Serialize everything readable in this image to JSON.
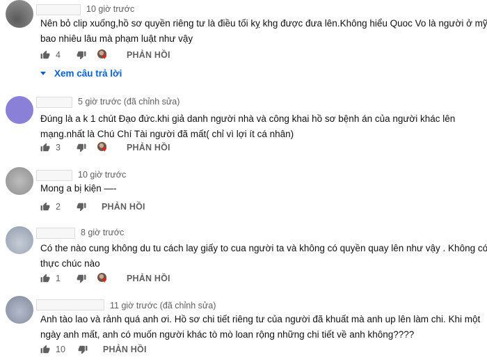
{
  "reply_label": "PHẢN HỒI",
  "comments": [
    {
      "time": "10 giờ trước",
      "line1": "Nên bỏ clip xuống,hồ sơ quyền riêng tư là điều tối kỵ khg được đưa lên.Không hiểu Quoc Vo là người ở mỹ",
      "line2": "bao nhiêu lâu mà phạm luật như vậy",
      "likes": "4",
      "view_replies": "Xem câu trả lời"
    },
    {
      "time": "5 giờ trước (đã chỉnh sửa)",
      "line1": "Đúng là a k 1 chút Đạo đức.khi giả danh người nhà và công khai hồ sơ bệnh án của người khác lên",
      "line2": "mạng.nhất là Chú Chí Tài người đã mất( chỉ vì lợi ít cá nhân)",
      "likes": "3"
    },
    {
      "time": "10 giờ trước",
      "line1": "Mong a bị kiện —-",
      "likes": "2"
    },
    {
      "time": "8 giờ trước",
      "line1": "Có the nào cung không du tu cách lay giấy to cua người ta và không có quyền quay lên như vậy . Không có y",
      "line2": "thực chúc nào",
      "likes": "1"
    },
    {
      "time": "11 giờ trước (đã chỉnh sửa)",
      "line1": "Anh tào lao và rảnh quá anh ơi. Hồ sơ chi tiết riêng tư của người đã  khuất mà anh up lên làm chi. Khi một",
      "line2": "ngày anh mất,  anh có muốn người khác tò mò loan rộng những chi tiết về anh không????",
      "likes": "10"
    }
  ],
  "colors": {
    "avatar1": "#7c7c7c",
    "avatar2": "#8a80d8",
    "avatar3": "#a0a0a0",
    "avatar4": "#a9b4c2",
    "avatar5": "#98a0b4",
    "link": "#065fd4"
  }
}
